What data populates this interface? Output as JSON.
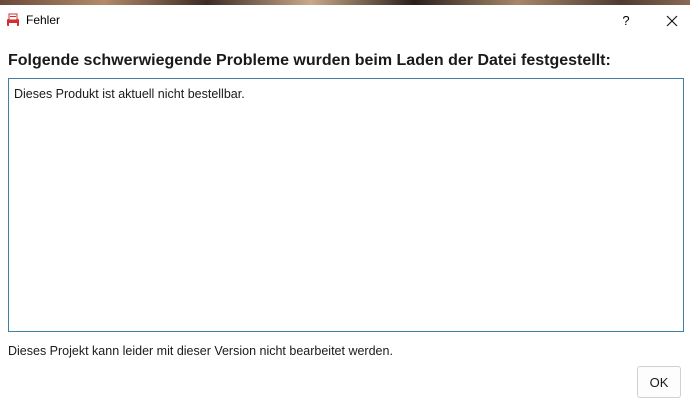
{
  "window": {
    "title": "Fehler",
    "app_icon": "printer-app-icon",
    "help_label": "?",
    "close_icon": "close-icon"
  },
  "dialog": {
    "heading": "Folgende schwerwiegende Probleme wurden beim Laden der Datei festgestellt:",
    "message": "Dieses Produkt ist aktuell nicht bestellbar.",
    "footer": "Dieses Projekt kann leider mit dieser Version nicht bearbeitet werden.",
    "ok_label": "OK"
  },
  "colors": {
    "accent_border": "#3f7fa4",
    "icon_red": "#d32f2f"
  }
}
